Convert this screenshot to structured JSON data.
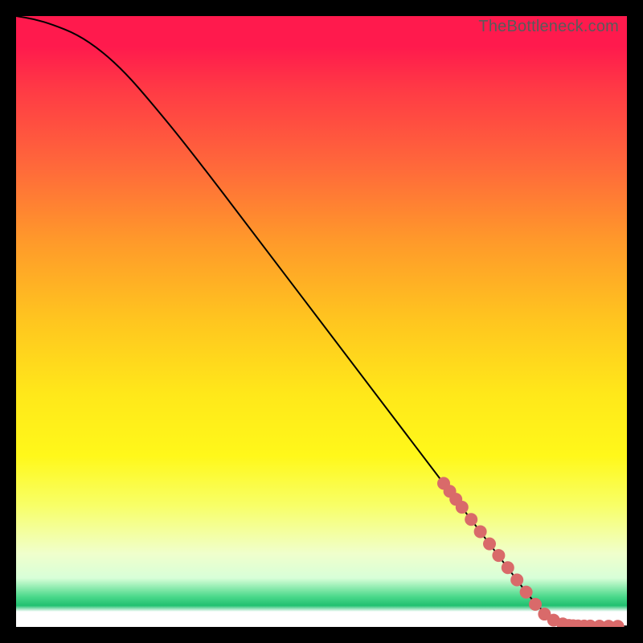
{
  "watermark": "TheBottleneck.com",
  "chart_data": {
    "type": "line",
    "title": "",
    "xlabel": "",
    "ylabel": "",
    "xlim": [
      0,
      100
    ],
    "ylim": [
      0,
      100
    ],
    "series": [
      {
        "name": "curve",
        "x": [
          0,
          3,
          6,
          10,
          14,
          18,
          22,
          28,
          40,
          55,
          70,
          80,
          86,
          90,
          92,
          95,
          100
        ],
        "y": [
          100,
          99.5,
          98.6,
          97,
          94.3,
          90.6,
          86,
          78.7,
          63,
          43.2,
          23.5,
          10.3,
          2.4,
          0.3,
          0.15,
          0.12,
          0.1
        ]
      },
      {
        "name": "markers",
        "x": [
          70,
          71,
          72,
          73,
          74.5,
          76,
          77.5,
          79,
          80.5,
          82,
          83.5,
          85,
          86.5,
          88,
          89.5,
          90.5,
          91.2,
          92,
          93,
          94,
          95.5,
          97,
          98.5
        ],
        "y": [
          23.5,
          22.2,
          20.9,
          19.6,
          17.6,
          15.6,
          13.6,
          11.7,
          9.7,
          7.7,
          5.7,
          3.7,
          2.1,
          1.1,
          0.5,
          0.25,
          0.2,
          0.17,
          0.15,
          0.14,
          0.13,
          0.12,
          0.1
        ]
      }
    ],
    "gradient_stops": [
      {
        "pos": 0,
        "color": "#ff1a4d"
      },
      {
        "pos": 50,
        "color": "#ffe81a"
      },
      {
        "pos": 95,
        "color": "#4dd98c"
      },
      {
        "pos": 100,
        "color": "#ffffff"
      }
    ]
  }
}
